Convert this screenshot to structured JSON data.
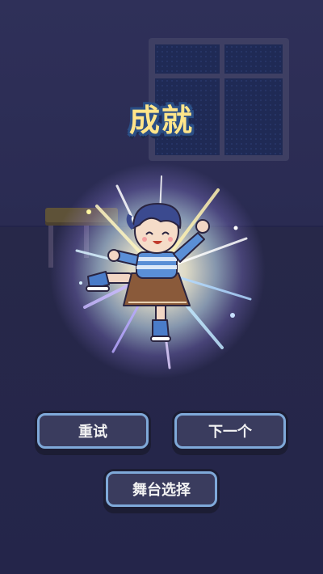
{
  "title": "成就",
  "buttons": {
    "retry": "重试",
    "next": "下一个",
    "stage_select": "舞台选择"
  },
  "colors": {
    "background": "#2c2d55",
    "title_text": "#ffe58a",
    "title_outline": "#2b4f86",
    "button_fill": "#3a3c5e",
    "button_border": "#7fa9d9"
  },
  "scene": {
    "character": "cheering-character-icon",
    "effect": "light-burst-icon",
    "background": "classroom-night"
  }
}
